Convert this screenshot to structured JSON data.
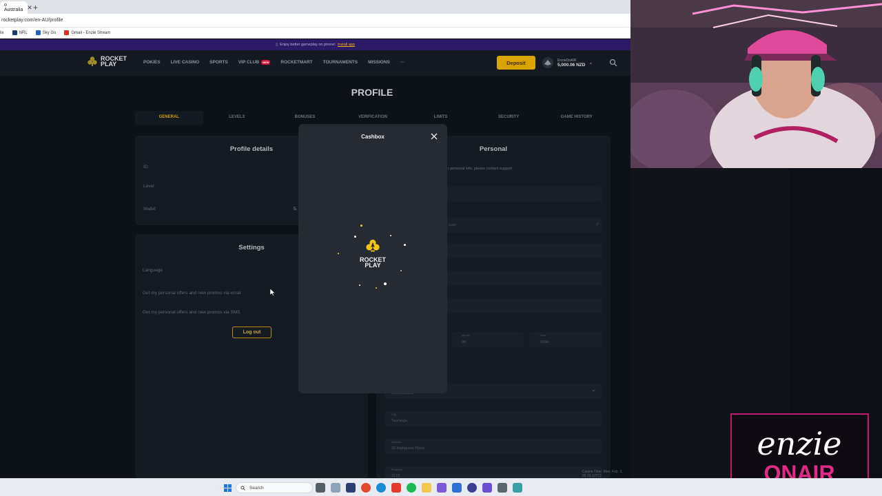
{
  "browser": {
    "tab_title": "o Australia",
    "url": "rocketplay.com/en-AU/profile",
    "bookmarks": [
      "lix",
      "NRL",
      "Sky Go",
      "Gmail - Enzie Stream"
    ]
  },
  "site": {
    "promo_text": "Enjoy better gameplay on phone!",
    "promo_link": "Install app",
    "logo_line1": "ROCKET",
    "logo_line2": "PLAY",
    "nav": [
      "POKIES",
      "LIVE CASINO",
      "SPORTS",
      "VIP CLUB",
      "ROCKETMART",
      "TOURNAMENTS",
      "MISSIONS",
      "···"
    ],
    "vip_badge": "NEW",
    "deposit_label": "Deposit",
    "user_name": "EnzieOnAIR",
    "user_balance": "5,000.06 NZD"
  },
  "profile": {
    "title": "PROFILE",
    "tabs": [
      "GENERAL",
      "LEVELS",
      "BONUSES",
      "VERIFICATION",
      "LIMITS",
      "SECURITY",
      "GAME HISTORY"
    ],
    "details_title": "Profile details",
    "id_label": "ID:",
    "level_label": "Level",
    "wallet_label": "Wallet",
    "wallet_value": "5.",
    "settings_title": "Settings",
    "language_label": "Language",
    "email_promo": "Get my personal offers and new promos via email",
    "sms_promo": "Get my personal offers and new promos via SMS",
    "logout_label": "Log out",
    "personal_title": "Personal",
    "personal_note": "r personal info, please contact support",
    "email_partial": ".com",
    "month_label": "Month",
    "month_value": "08",
    "year_label": "Year",
    "year_value": "1994",
    "country_value": "New Zealand",
    "city_label": "City",
    "city_value": "Tauranga",
    "address_label": "Address",
    "address_value": "20 Highgrove Place",
    "postcode_label": "Postcode",
    "postcode_value": "3110",
    "casino_time": "Casino Time: Mon, Feb. 2, 09:15 (UTC)"
  },
  "modal": {
    "title": "Cashbox",
    "logo_line1": "ROCKET",
    "logo_line2": "PLAY"
  },
  "taskbar": {
    "search_placeholder": "Search"
  },
  "overlay": {
    "brand_line1": "enzie",
    "brand_line2": "ONAIR"
  },
  "colors": {
    "accent": "#d9a400",
    "modal_bg": "#252a33",
    "brand_pink": "#c21a6c"
  }
}
